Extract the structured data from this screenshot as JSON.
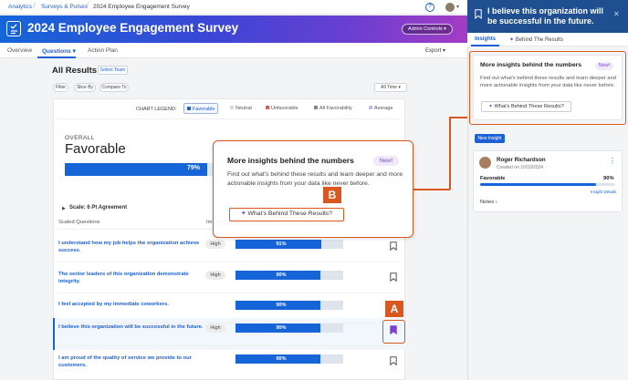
{
  "breadcrumb": {
    "items": [
      "Analytics",
      "Surveys & Pulses",
      "2024 Employee Engagement Survey"
    ],
    "sep": "/"
  },
  "header": {
    "title": "2024 Employee Engagement Survey",
    "admin_controls": "Admin Controls ▾",
    "help": "?"
  },
  "tabs": {
    "overview": "Overview",
    "questions": "Questions ▾",
    "action_plan": "Action Plan",
    "export": "Export ▾"
  },
  "toolbar": {
    "all_results": "All Results",
    "select_team": "Select Team",
    "filter": "Filter",
    "slice_by": "Slice By",
    "compare_to": "Compare To",
    "all_time": "All Time ▾"
  },
  "legend": {
    "label": "CHART LEGEND:",
    "items": [
      {
        "label": "Favorable",
        "color": "#1565d8"
      },
      {
        "label": "Neutral",
        "color": "#d7dce3"
      },
      {
        "label": "Unfavorable",
        "color": "#e05757"
      },
      {
        "label": "All Favorability",
        "color": "#888888"
      },
      {
        "label": "Average",
        "color": "#c9b8e8"
      }
    ]
  },
  "overall": {
    "label": "OVERALL",
    "value": "Favorable",
    "percent": 79,
    "percent_label": "79%"
  },
  "scale": {
    "label": "Scale: 6 Pt Agreement",
    "col_questions": "Scaled Questions",
    "col_importance": "Im"
  },
  "questions": [
    {
      "text": "I understand how my job helps the organization achieve success.",
      "importance": "High",
      "percent": 91,
      "percent_label": "91%"
    },
    {
      "text": "The senior leaders of this organization demonstrate integrity.",
      "importance": "High",
      "percent": 90,
      "percent_label": "90%"
    },
    {
      "text": "I feel accepted by my immediate coworkers.",
      "importance": "",
      "percent": 90,
      "percent_label": "90%"
    },
    {
      "text": "I believe this organization will be successful in the future.",
      "importance": "High",
      "percent": 90,
      "percent_label": "90%"
    },
    {
      "text": "I am proud of the quality of service we provide to our customers.",
      "importance": "",
      "percent": 90,
      "percent_label": "90%"
    }
  ],
  "popover": {
    "title": "More insights behind the numbers",
    "badge": "New!",
    "text": "Find out what's behind these results and learn deeper and more actionable insights from your data like never before.",
    "button": "What's Behind These Results?"
  },
  "markers": {
    "a": "A",
    "b": "B"
  },
  "panel": {
    "title": "I believe this organization will be successful in the future.",
    "close": "✕",
    "tab_insights": "Insights",
    "tab_behind": "Behind The Results",
    "card_title": "More insights behind the numbers",
    "card_badge": "New!",
    "card_text": "Find out what's behind these results and learn deeper and more actionable insights from your data like never before.",
    "card_button": "What's Behind These Results?",
    "new_insight": "New Insight",
    "insight": {
      "author": "Roger Richardson",
      "created": "Created on 10/10/2024",
      "label": "Favorable",
      "percent": 90,
      "percent_label": "90%",
      "details": "Insight Details",
      "notes": "Notes ›"
    }
  },
  "colors": {
    "accent": "#1d5fd6",
    "callout": "#d9581f",
    "panel_header": "#1f4f91",
    "bookmark_active": "#7b3fd4"
  }
}
